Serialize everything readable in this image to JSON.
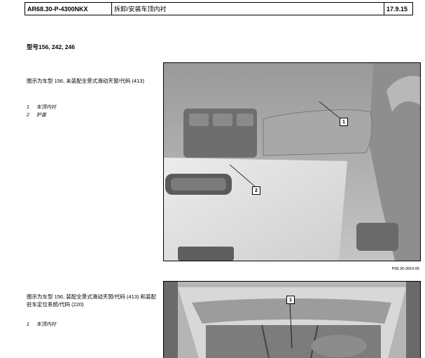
{
  "header": {
    "doc_code": "AR68.30-P-4300NKX",
    "title": "拆卸/安装车顶内衬",
    "date": "17.9.15"
  },
  "model_line": "型号156, 242, 246",
  "section1": {
    "caption": "图示为车型 156, 未装配全景式滑动天窗/代码 (413)",
    "legend": [
      {
        "num": "1",
        "text": "车顶内衬"
      },
      {
        "num": "2",
        "text": "护盖"
      }
    ],
    "callouts": [
      "1",
      "2"
    ],
    "figure_code": "P68.30-3663-06"
  },
  "section2": {
    "caption": "图示为车型 156, 装配全景式滑动天窗/代码 (413) 和装配驻车定位系统/代码 (220)",
    "legend": [
      {
        "num": "1",
        "text": "车顶内衬"
      }
    ],
    "callouts": [
      "1"
    ]
  }
}
